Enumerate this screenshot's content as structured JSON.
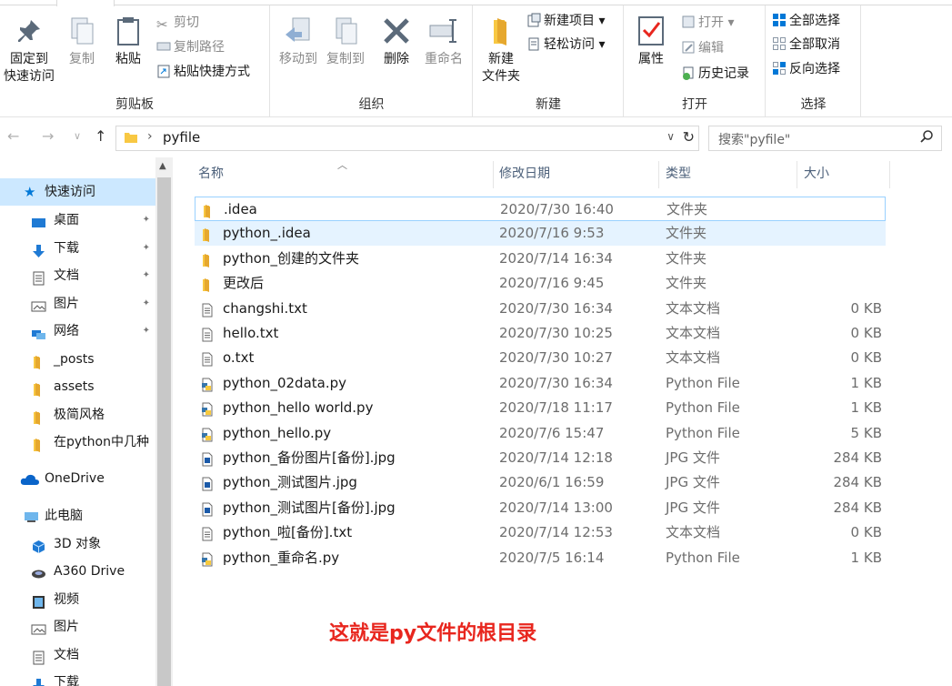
{
  "ribbon": {
    "clipboard": {
      "pin_label_1": "固定到",
      "pin_label_2": "快速访问",
      "copy": "复制",
      "paste": "粘贴",
      "cut": "剪切",
      "copy_path": "复制路径",
      "paste_shortcut": "粘贴快捷方式",
      "group": "剪贴板"
    },
    "organize": {
      "move_to": "移动到",
      "copy_to": "复制到",
      "delete": "删除",
      "rename": "重命名",
      "group": "组织"
    },
    "new": {
      "new_folder_1": "新建",
      "new_folder_2": "文件夹",
      "new_item": "新建项目 ▾",
      "easy_access": "轻松访问 ▾",
      "group": "新建"
    },
    "open": {
      "properties": "属性",
      "open": "打开 ▾",
      "edit": "编辑",
      "history": "历史记录",
      "group": "打开"
    },
    "select": {
      "select_all": "全部选择",
      "select_none": "全部取消",
      "invert": "反向选择",
      "group": "选择"
    }
  },
  "address": {
    "path": "pyfile",
    "search_placeholder": "搜索\"pyfile\""
  },
  "nav": {
    "quick_access": "快速访问",
    "items": [
      {
        "label": "桌面",
        "pinned": true
      },
      {
        "label": "下载",
        "pinned": true
      },
      {
        "label": "文档",
        "pinned": true
      },
      {
        "label": "图片",
        "pinned": true
      },
      {
        "label": "网络",
        "pinned": true
      },
      {
        "label": "_posts"
      },
      {
        "label": "assets"
      },
      {
        "label": "极简风格"
      },
      {
        "label": "在python中几种"
      }
    ],
    "onedrive": "OneDrive",
    "this_pc": "此电脑",
    "pc_items": [
      {
        "label": "3D 对象"
      },
      {
        "label": "A360 Drive"
      },
      {
        "label": "视频"
      },
      {
        "label": "图片"
      },
      {
        "label": "文档"
      },
      {
        "label": "下载"
      }
    ]
  },
  "columns": {
    "name": "名称",
    "date": "修改日期",
    "type": "类型",
    "size": "大小"
  },
  "files": [
    {
      "name": ".idea",
      "date": "2020/7/30 16:40",
      "type": "文件夹",
      "size": "",
      "kind": "folder"
    },
    {
      "name": "python_.idea",
      "date": "2020/7/16 9:53",
      "type": "文件夹",
      "size": "",
      "kind": "folder"
    },
    {
      "name": "python_创建的文件夹",
      "date": "2020/7/14 16:34",
      "type": "文件夹",
      "size": "",
      "kind": "folder"
    },
    {
      "name": "更改后",
      "date": "2020/7/16 9:45",
      "type": "文件夹",
      "size": "",
      "kind": "folder"
    },
    {
      "name": "changshi.txt",
      "date": "2020/7/30 16:34",
      "type": "文本文档",
      "size": "0 KB",
      "kind": "txt"
    },
    {
      "name": "hello.txt",
      "date": "2020/7/30 10:25",
      "type": "文本文档",
      "size": "0 KB",
      "kind": "txt"
    },
    {
      "name": "o.txt",
      "date": "2020/7/30 10:27",
      "type": "文本文档",
      "size": "0 KB",
      "kind": "txt"
    },
    {
      "name": "python_02data.py",
      "date": "2020/7/30 16:34",
      "type": "Python File",
      "size": "1 KB",
      "kind": "py"
    },
    {
      "name": "python_hello world.py",
      "date": "2020/7/18 11:17",
      "type": "Python File",
      "size": "1 KB",
      "kind": "py"
    },
    {
      "name": "python_hello.py",
      "date": "2020/7/6 15:47",
      "type": "Python File",
      "size": "5 KB",
      "kind": "py"
    },
    {
      "name": "python_备份图片[备份].jpg",
      "date": "2020/7/14 12:18",
      "type": "JPG 文件",
      "size": "284 KB",
      "kind": "jpg"
    },
    {
      "name": "python_测试图片.jpg",
      "date": "2020/6/1 16:59",
      "type": "JPG 文件",
      "size": "284 KB",
      "kind": "jpg"
    },
    {
      "name": "python_测试图片[备份].jpg",
      "date": "2020/7/14 13:00",
      "type": "JPG 文件",
      "size": "284 KB",
      "kind": "jpg"
    },
    {
      "name": "python_啦[备份].txt",
      "date": "2020/7/14 12:53",
      "type": "文本文档",
      "size": "0 KB",
      "kind": "txt"
    },
    {
      "name": "python_重命名.py",
      "date": "2020/7/5 16:14",
      "type": "Python File",
      "size": "1 KB",
      "kind": "py"
    }
  ],
  "annotation": "这就是py文件的根目录",
  "colors": {
    "accent": "#0078d7",
    "folder": "#f8c843",
    "annotation": "#e8261e",
    "selection": "#cce8ff"
  }
}
